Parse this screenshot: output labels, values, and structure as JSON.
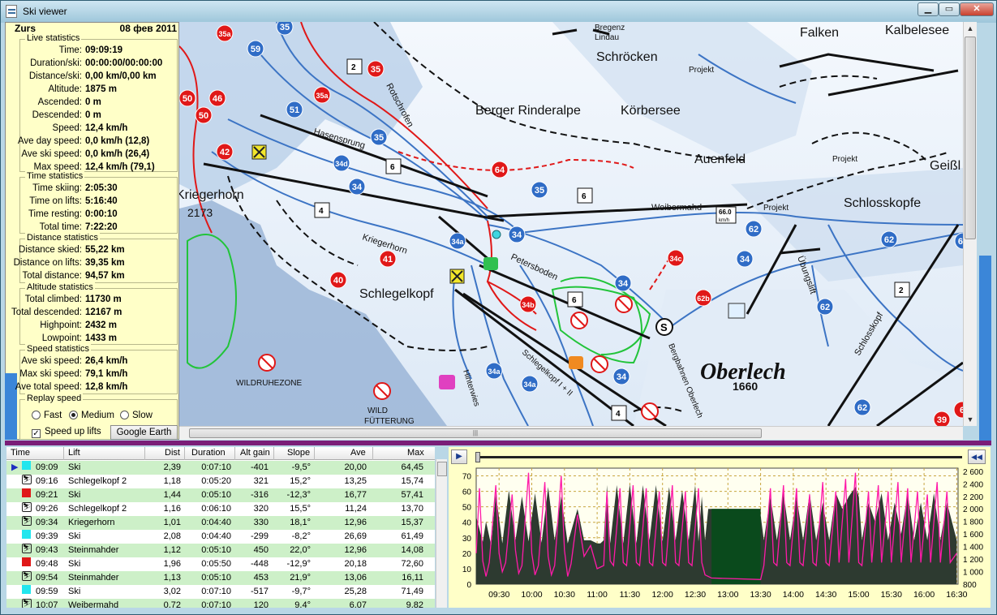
{
  "window": {
    "title": "Ski viewer",
    "controls": [
      "minimize",
      "maximize",
      "close"
    ]
  },
  "header": {
    "resort": "Zurs",
    "date": "08 фев 2011"
  },
  "live_statistics": {
    "title": "Live statistics",
    "rows": [
      {
        "label": "Time:",
        "value": "09:09:19"
      },
      {
        "label": "Duration/ski:",
        "value": "00:00:00/00:00:00"
      },
      {
        "label": "Distance/ski:",
        "value": "0,00 km/0,00 km"
      },
      {
        "label": "Altitude:",
        "value": "1875 m"
      },
      {
        "label": "Ascended:",
        "value": "0 m"
      },
      {
        "label": "Descended:",
        "value": "0 m"
      },
      {
        "label": "Speed:",
        "value": "12,4 km/h"
      },
      {
        "label": "Ave day speed:",
        "value": "0,0 km/h (12,8)"
      },
      {
        "label": "Ave ski speed:",
        "value": "0,0 km/h (26,4)"
      },
      {
        "label": "Max speed:",
        "value": "12,4 km/h (79,1)"
      }
    ]
  },
  "time_statistics": {
    "title": "Time statistics",
    "rows": [
      {
        "label": "Time skiing:",
        "value": "2:05:30"
      },
      {
        "label": "Time on lifts:",
        "value": "5:16:40"
      },
      {
        "label": "Time resting:",
        "value": "0:00:10"
      },
      {
        "label": "Total time:",
        "value": "7:22:20"
      }
    ]
  },
  "distance_statistics": {
    "title": "Distance statistics",
    "rows": [
      {
        "label": "Distance skied:",
        "value": "55,22 km"
      },
      {
        "label": "Distance on lifts:",
        "value": "39,35 km"
      },
      {
        "label": "Total distance:",
        "value": "94,57 km"
      }
    ]
  },
  "altitude_statistics": {
    "title": "Altitude statistics",
    "rows": [
      {
        "label": "Total climbed:",
        "value": "11730 m"
      },
      {
        "label": "Total descended:",
        "value": "12167 m"
      },
      {
        "label": "Highpoint:",
        "value": "2432 m"
      },
      {
        "label": "Lowpoint:",
        "value": "1433 m"
      }
    ]
  },
  "speed_statistics": {
    "title": "Speed statistics",
    "rows": [
      {
        "label": "Ave ski speed:",
        "value": "26,4 km/h"
      },
      {
        "label": "Max ski speed:",
        "value": "79,1 km/h"
      },
      {
        "label": "Ave total speed:",
        "value": "12,8 km/h"
      }
    ]
  },
  "replay_speed": {
    "title": "Replay speed",
    "options": [
      "Fast",
      "Medium",
      "Slow"
    ],
    "selected": "Medium",
    "speed_up_lifts_label": "Speed up lifts",
    "speed_up_lifts_checked": true,
    "google_earth_label": "Google Earth"
  },
  "map": {
    "place_labels": [
      "Bregenz",
      "Lindau",
      "Schröcken",
      "Falken",
      "Kalbelesee",
      "Projekt",
      "Berger Rinderalpe",
      "Körbersee",
      "Auenfeld",
      "Geißl",
      "Projekt",
      "Schlosskopfe",
      "Weibermahd",
      "Projekt",
      "Kriegerhorn",
      "2173",
      "Kriegerhorn",
      "Hasensprung",
      "Rotschrofen",
      "Petersboden",
      "Schlegelkopf",
      "Übungslift",
      "Schlosskopf",
      "Oberlech",
      "1660",
      "Bergbahnen Oberlech",
      "Schlegelkopf I + II",
      "Hinterwies",
      "WILDRUHEZONE",
      "WILD",
      "FÜTTERUNG"
    ],
    "speed_sign": "66.0",
    "speed_unit": "km/h",
    "piste_numbers": [
      "35",
      "35a",
      "59",
      "35",
      "50",
      "46",
      "35a",
      "50",
      "51",
      "35",
      "64",
      "42",
      "34d",
      "35",
      "34",
      "34",
      "62",
      "34a",
      "34",
      "62",
      "62",
      "41",
      "34c",
      "40",
      "34",
      "62b",
      "34b",
      "62",
      "34a",
      "34a",
      "34",
      "62",
      "39",
      "6"
    ],
    "lift_numbers": [
      "2",
      "6",
      "4",
      "6",
      "6",
      "4",
      "2"
    ]
  },
  "table": {
    "columns": [
      "Time",
      "Lift",
      "Dist",
      "Duration",
      "Alt gain",
      "Slope",
      "Ave",
      "Max"
    ],
    "rows": [
      {
        "type": "ski",
        "color": "#22e6ee",
        "time": "09:09",
        "lift": "Ski",
        "dist": "2,39",
        "duration": "0:07:10",
        "alt": "-401",
        "slope": "-9,5°",
        "ave": "20,00",
        "max": "64,45",
        "current": true
      },
      {
        "type": "lift",
        "time": "09:16",
        "lift": "Schlegelkopf 2",
        "dist": "1,18",
        "duration": "0:05:20",
        "alt": "321",
        "slope": "15,2°",
        "ave": "13,25",
        "max": "15,74"
      },
      {
        "type": "ski",
        "color": "#e01818",
        "time": "09:21",
        "lift": "Ski",
        "dist": "1,44",
        "duration": "0:05:10",
        "alt": "-316",
        "slope": "-12,3°",
        "ave": "16,77",
        "max": "57,41"
      },
      {
        "type": "lift",
        "time": "09:26",
        "lift": "Schlegelkopf 2",
        "dist": "1,16",
        "duration": "0:06:10",
        "alt": "320",
        "slope": "15,5°",
        "ave": "11,24",
        "max": "13,70"
      },
      {
        "type": "lift",
        "time": "09:34",
        "lift": "Kriegerhorn",
        "dist": "1,01",
        "duration": "0:04:40",
        "alt": "330",
        "slope": "18,1°",
        "ave": "12,96",
        "max": "15,37"
      },
      {
        "type": "ski",
        "color": "#22e6ee",
        "time": "09:39",
        "lift": "Ski",
        "dist": "2,08",
        "duration": "0:04:40",
        "alt": "-299",
        "slope": "-8,2°",
        "ave": "26,69",
        "max": "61,49"
      },
      {
        "type": "lift",
        "time": "09:43",
        "lift": "Steinmahder",
        "dist": "1,12",
        "duration": "0:05:10",
        "alt": "450",
        "slope": "22,0°",
        "ave": "12,96",
        "max": "14,08"
      },
      {
        "type": "ski",
        "color": "#e01818",
        "time": "09:48",
        "lift": "Ski",
        "dist": "1,96",
        "duration": "0:05:50",
        "alt": "-448",
        "slope": "-12,9°",
        "ave": "20,18",
        "max": "72,60"
      },
      {
        "type": "lift",
        "time": "09:54",
        "lift": "Steinmahder",
        "dist": "1,13",
        "duration": "0:05:10",
        "alt": "453",
        "slope": "21,9°",
        "ave": "13,06",
        "max": "16,11"
      },
      {
        "type": "ski",
        "color": "#22e6ee",
        "time": "09:59",
        "lift": "Ski",
        "dist": "3,02",
        "duration": "0:07:10",
        "alt": "-517",
        "slope": "-9,7°",
        "ave": "25,28",
        "max": "71,49"
      },
      {
        "type": "lift",
        "time": "10:07",
        "lift": "Weibermahd",
        "dist": "0,72",
        "duration": "0:07:10",
        "alt": "120",
        "slope": "9,4°",
        "ave": "6,07",
        "max": "9,82"
      }
    ]
  },
  "chart_data": {
    "type": "area",
    "x_ticks": [
      "09:30",
      "10:00",
      "10:30",
      "11:00",
      "11:30",
      "12:00",
      "12:30",
      "13:00",
      "13:30",
      "14:00",
      "14:30",
      "15:00",
      "15:30",
      "16:00",
      "16:30"
    ],
    "y_left_ticks": [
      "0",
      "10",
      "20",
      "30",
      "40",
      "50",
      "60",
      "70"
    ],
    "y_right_ticks": [
      "800",
      "1 000",
      "1 200",
      "1 400",
      "1 600",
      "1 800",
      "2 000",
      "2 200",
      "2 400",
      "2 600"
    ],
    "ylim_left": [
      0,
      75
    ],
    "ylim_right": [
      800,
      2650
    ],
    "x_range": [
      "09:09",
      "16:31"
    ],
    "colors": {
      "altitude": "#2d3a30",
      "speed": "#ff1aa8",
      "lift_flat": "#0a4a1c"
    },
    "altitude_series": [
      [
        9.15,
        1875
      ],
      [
        9.25,
        1475
      ],
      [
        9.3,
        1800
      ],
      [
        9.38,
        1420
      ],
      [
        9.45,
        2250
      ],
      [
        9.55,
        1450
      ],
      [
        9.65,
        2300
      ],
      [
        9.75,
        1500
      ],
      [
        9.85,
        2200
      ],
      [
        9.95,
        1480
      ],
      [
        10.05,
        2250
      ],
      [
        10.15,
        1460
      ],
      [
        10.25,
        2350
      ],
      [
        10.35,
        1500
      ],
      [
        10.45,
        2200
      ],
      [
        10.55,
        1450
      ],
      [
        10.7,
        2000
      ],
      [
        10.8,
        1500
      ],
      [
        10.9,
        1500
      ],
      [
        11.0,
        1450
      ],
      [
        11.05,
        1450
      ],
      [
        11.1,
        1500
      ],
      [
        11.15,
        2380
      ],
      [
        11.2,
        1450
      ],
      [
        11.3,
        2380
      ],
      [
        11.4,
        1450
      ],
      [
        11.5,
        2400
      ],
      [
        11.6,
        1450
      ],
      [
        11.7,
        2380
      ],
      [
        11.8,
        1500
      ],
      [
        11.9,
        2380
      ],
      [
        12.0,
        1480
      ],
      [
        12.1,
        2350
      ],
      [
        12.2,
        1500
      ],
      [
        12.3,
        2300
      ],
      [
        12.4,
        1500
      ],
      [
        12.5,
        2380
      ],
      [
        12.55,
        1480
      ],
      [
        12.6,
        2200
      ],
      [
        12.65,
        1500
      ],
      [
        12.7,
        2000
      ],
      [
        12.75,
        2000
      ],
      [
        13.5,
        2000
      ],
      [
        13.5,
        1900
      ],
      [
        13.55,
        1500
      ],
      [
        13.65,
        2200
      ],
      [
        13.75,
        1500
      ],
      [
        13.85,
        2250
      ],
      [
        13.95,
        1500
      ],
      [
        14.05,
        2200
      ],
      [
        14.15,
        1500
      ],
      [
        14.25,
        2250
      ],
      [
        14.35,
        1500
      ],
      [
        14.45,
        2100
      ],
      [
        14.55,
        1500
      ],
      [
        14.65,
        2250
      ],
      [
        14.75,
        2000
      ],
      [
        14.85,
        2200
      ],
      [
        14.95,
        2350
      ],
      [
        15.0,
        2200
      ],
      [
        15.05,
        1500
      ],
      [
        15.15,
        2100
      ],
      [
        15.25,
        1800
      ],
      [
        15.35,
        2250
      ],
      [
        15.45,
        1500
      ],
      [
        15.55,
        2100
      ],
      [
        15.65,
        1600
      ],
      [
        15.75,
        2250
      ],
      [
        15.85,
        1500
      ],
      [
        15.95,
        2100
      ],
      [
        16.05,
        1500
      ],
      [
        16.15,
        2250
      ],
      [
        16.25,
        1500
      ],
      [
        16.35,
        2100
      ],
      [
        16.5,
        1500
      ]
    ],
    "speed_series": [
      [
        9.15,
        20
      ],
      [
        9.2,
        62
      ],
      [
        9.25,
        15
      ],
      [
        9.3,
        5
      ],
      [
        9.35,
        14
      ],
      [
        9.45,
        64
      ],
      [
        9.5,
        20
      ],
      [
        9.55,
        8
      ],
      [
        9.6,
        14
      ],
      [
        9.7,
        58
      ],
      [
        9.75,
        22
      ],
      [
        9.8,
        7
      ],
      [
        9.85,
        12
      ],
      [
        9.95,
        72
      ],
      [
        10.0,
        20
      ],
      [
        10.05,
        6
      ],
      [
        10.1,
        12
      ],
      [
        10.2,
        66
      ],
      [
        10.25,
        18
      ],
      [
        10.3,
        6
      ],
      [
        10.35,
        12
      ],
      [
        10.45,
        70
      ],
      [
        10.5,
        22
      ],
      [
        10.55,
        5
      ],
      [
        10.6,
        13
      ],
      [
        10.7,
        45
      ],
      [
        10.8,
        18
      ],
      [
        10.9,
        25
      ],
      [
        11.0,
        10
      ],
      [
        11.1,
        12
      ],
      [
        11.15,
        60
      ],
      [
        11.2,
        15
      ],
      [
        11.25,
        12
      ],
      [
        11.35,
        62
      ],
      [
        11.4,
        14
      ],
      [
        11.45,
        12
      ],
      [
        11.55,
        64
      ],
      [
        11.6,
        14
      ],
      [
        11.65,
        12
      ],
      [
        11.75,
        62
      ],
      [
        11.8,
        14
      ],
      [
        11.85,
        12
      ],
      [
        11.95,
        60
      ],
      [
        12.0,
        14
      ],
      [
        12.05,
        12
      ],
      [
        12.15,
        64
      ],
      [
        12.2,
        14
      ],
      [
        12.25,
        12
      ],
      [
        12.35,
        60
      ],
      [
        12.4,
        14
      ],
      [
        12.45,
        12
      ],
      [
        12.55,
        62
      ],
      [
        12.6,
        14
      ],
      [
        12.65,
        6
      ],
      [
        12.75,
        4
      ],
      [
        13.5,
        3
      ],
      [
        13.55,
        12
      ],
      [
        13.65,
        62
      ],
      [
        13.7,
        14
      ],
      [
        13.75,
        12
      ],
      [
        13.85,
        64
      ],
      [
        13.9,
        14
      ],
      [
        13.95,
        12
      ],
      [
        14.05,
        62
      ],
      [
        14.1,
        14
      ],
      [
        14.15,
        12
      ],
      [
        14.25,
        58
      ],
      [
        14.3,
        14
      ],
      [
        14.35,
        12
      ],
      [
        14.45,
        66
      ],
      [
        14.5,
        14
      ],
      [
        14.55,
        12
      ],
      [
        14.65,
        60
      ],
      [
        14.7,
        14
      ],
      [
        14.8,
        68
      ],
      [
        14.85,
        14
      ],
      [
        14.95,
        72
      ],
      [
        15.0,
        14
      ],
      [
        15.05,
        12
      ],
      [
        15.15,
        60
      ],
      [
        15.2,
        14
      ],
      [
        15.3,
        64
      ],
      [
        15.35,
        14
      ],
      [
        15.45,
        60
      ],
      [
        15.5,
        14
      ],
      [
        15.6,
        66
      ],
      [
        15.65,
        14
      ],
      [
        15.75,
        62
      ],
      [
        15.8,
        14
      ],
      [
        15.9,
        60
      ],
      [
        15.95,
        14
      ],
      [
        16.05,
        58
      ],
      [
        16.1,
        14
      ],
      [
        16.2,
        66
      ],
      [
        16.25,
        14
      ],
      [
        16.35,
        60
      ],
      [
        16.4,
        14
      ],
      [
        16.5,
        20
      ]
    ]
  }
}
